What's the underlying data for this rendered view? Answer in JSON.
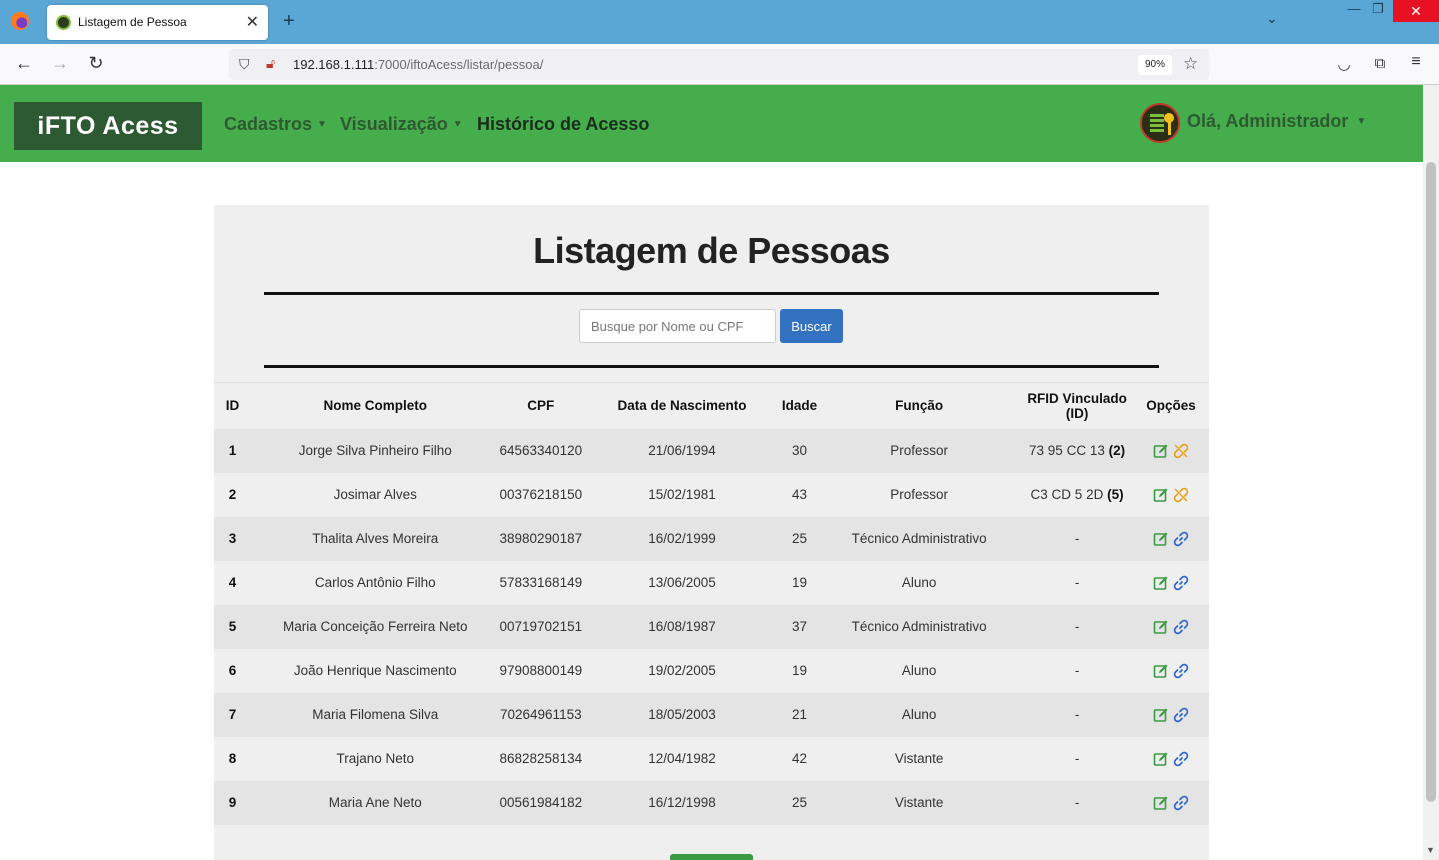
{
  "browser": {
    "tab_title": "Listagem de Pessoa",
    "url_host": "192.168.1.111",
    "url_path": ":7000/iftoAcess/listar/pessoa/",
    "zoom": "90%"
  },
  "header": {
    "brand": "iFTO Acess",
    "menu": [
      {
        "label": "Cadastros",
        "dropdown": true
      },
      {
        "label": "Visualização",
        "dropdown": true
      },
      {
        "label": "Histórico de Acesso",
        "dropdown": false
      }
    ],
    "user_greeting": "Olá, Administrador"
  },
  "page": {
    "title": "Listagem de Pessoas",
    "search_placeholder": "Busque por Nome ou CPF",
    "search_button": "Buscar"
  },
  "table": {
    "columns": [
      "ID",
      "Nome Completo",
      "CPF",
      "Data de Nascimento",
      "Idade",
      "Função",
      "RFID Vinculado (ID)",
      "Opções"
    ],
    "rows": [
      {
        "id": "1",
        "nome": "Jorge Silva Pinheiro Filho",
        "cpf": "64563340120",
        "nascimento": "21/06/1994",
        "idade": "30",
        "funcao": "Professor",
        "rfid": "73 95 CC 13",
        "rfid_id": "(2)",
        "linked": true
      },
      {
        "id": "2",
        "nome": "Josimar Alves",
        "cpf": "00376218150",
        "nascimento": "15/02/1981",
        "idade": "43",
        "funcao": "Professor",
        "rfid": "C3 CD 5 2D",
        "rfid_id": "(5)",
        "linked": true
      },
      {
        "id": "3",
        "nome": "Thalita Alves Moreira",
        "cpf": "38980290187",
        "nascimento": "16/02/1999",
        "idade": "25",
        "funcao": "Técnico Administrativo",
        "rfid": "-",
        "rfid_id": "",
        "linked": false
      },
      {
        "id": "4",
        "nome": "Carlos Antônio Filho",
        "cpf": "57833168149",
        "nascimento": "13/06/2005",
        "idade": "19",
        "funcao": "Aluno",
        "rfid": "-",
        "rfid_id": "",
        "linked": false
      },
      {
        "id": "5",
        "nome": "Maria Conceição Ferreira Neto",
        "cpf": "00719702151",
        "nascimento": "16/08/1987",
        "idade": "37",
        "funcao": "Técnico Administrativo",
        "rfid": "-",
        "rfid_id": "",
        "linked": false
      },
      {
        "id": "6",
        "nome": "João Henrique Nascimento",
        "cpf": "97908800149",
        "nascimento": "19/02/2005",
        "idade": "19",
        "funcao": "Aluno",
        "rfid": "-",
        "rfid_id": "",
        "linked": false
      },
      {
        "id": "7",
        "nome": "Maria Filomena Silva",
        "cpf": "70264961153",
        "nascimento": "18/05/2003",
        "idade": "21",
        "funcao": "Aluno",
        "rfid": "-",
        "rfid_id": "",
        "linked": false
      },
      {
        "id": "8",
        "nome": "Trajano Neto",
        "cpf": "86828258134",
        "nascimento": "12/04/1982",
        "idade": "42",
        "funcao": "Vistante",
        "rfid": "-",
        "rfid_id": "",
        "linked": false
      },
      {
        "id": "9",
        "nome": "Maria Ane Neto",
        "cpf": "00561984182",
        "nascimento": "16/12/1998",
        "idade": "25",
        "funcao": "Vistante",
        "rfid": "-",
        "rfid_id": "",
        "linked": false
      }
    ]
  },
  "icons": {
    "edit": "edit-icon",
    "link": "link-icon",
    "unlink": "unlink-icon"
  },
  "colors": {
    "header_green": "#46ad4d",
    "brand_dark_green": "#2d5a32",
    "edit_green": "#3a9a42",
    "link_blue": "#2a64c8",
    "unlink_orange": "#e6a11c",
    "search_button": "#3272c0"
  }
}
